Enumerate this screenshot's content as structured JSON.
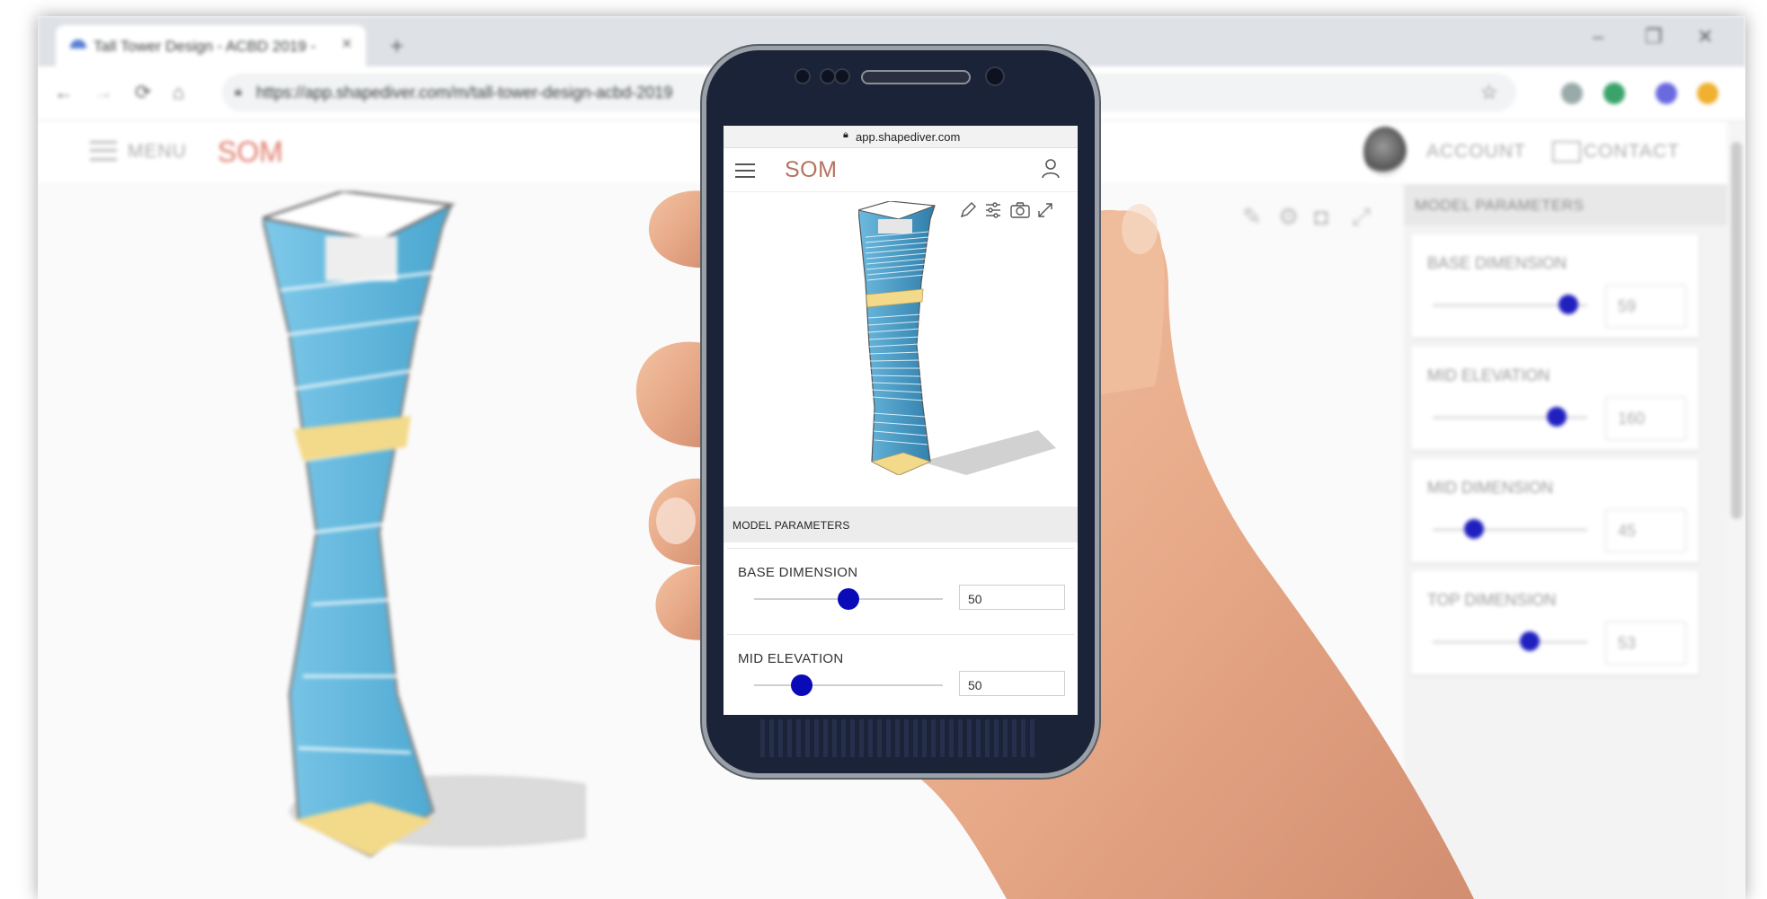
{
  "browser": {
    "tab_title": "Tall Tower Design - ACBD 2019 -",
    "url": "https://app.shapediver.com/m/tall-tower-design-acbd-2019"
  },
  "app": {
    "menu_label": "MENU",
    "logo": "SOM",
    "account_label": "ACCOUNT",
    "contact_label": "CONTACT",
    "panel_title": "MODEL PARAMETERS",
    "parameters": [
      {
        "label": "BASE DIMENSION",
        "value": "59",
        "fraction": 0.88
      },
      {
        "label": "MID ELEVATION",
        "value": "160",
        "fraction": 0.8
      },
      {
        "label": "MID DIMENSION",
        "value": "45",
        "fraction": 0.27
      },
      {
        "label": "TOP DIMENSION",
        "value": "53",
        "fraction": 0.63
      }
    ]
  },
  "phone": {
    "url": "app.shapediver.com",
    "logo": "SOM",
    "panel_title": "MODEL PARAMETERS",
    "parameters": [
      {
        "label": "BASE DIMENSION",
        "value": "50",
        "fraction": 0.5
      },
      {
        "label": "MID ELEVATION",
        "value": "50",
        "fraction": 0.25
      }
    ]
  },
  "colors": {
    "accent_knob": "#0a0ab8",
    "logo": "#b5735f",
    "glass": "#5ab4d6",
    "floor_plate": "#f3d98a"
  }
}
